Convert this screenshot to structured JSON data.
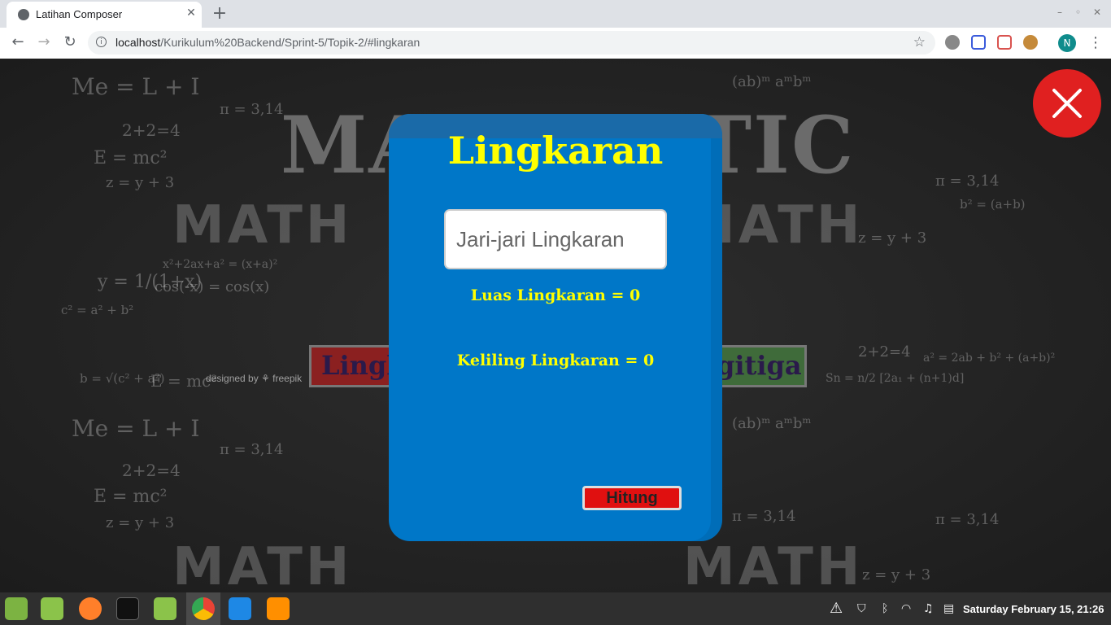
{
  "browser": {
    "tab_title": "Latihan Composer",
    "tab_close": "✕",
    "new_tab": "+",
    "url_host": "localhost",
    "url_path": "/Kurikulum%20Backend/Sprint-5/Topik-2/#lingkaran",
    "avatar_letter": "N"
  },
  "background": {
    "title": "MATEMATIC",
    "math_word": "MATH",
    "left_button": "Lingk",
    "right_button": "gitiga",
    "credit": "designed by ⚘ freepik"
  },
  "modal": {
    "title": "Lingkaran",
    "input_placeholder": "Jari-jari Lingkaran",
    "area_label": "Luas Lingkaran = 0",
    "circumference_label": "Keliling Lingkaran = 0",
    "submit_label": "Hitung"
  },
  "taskbar": {
    "clock": "Saturday February 15, 21:26"
  },
  "colors": {
    "modal_bg": "#0077c8",
    "title_yellow": "#ffff00",
    "close_red": "#e02020",
    "button_red": "#e01010"
  }
}
